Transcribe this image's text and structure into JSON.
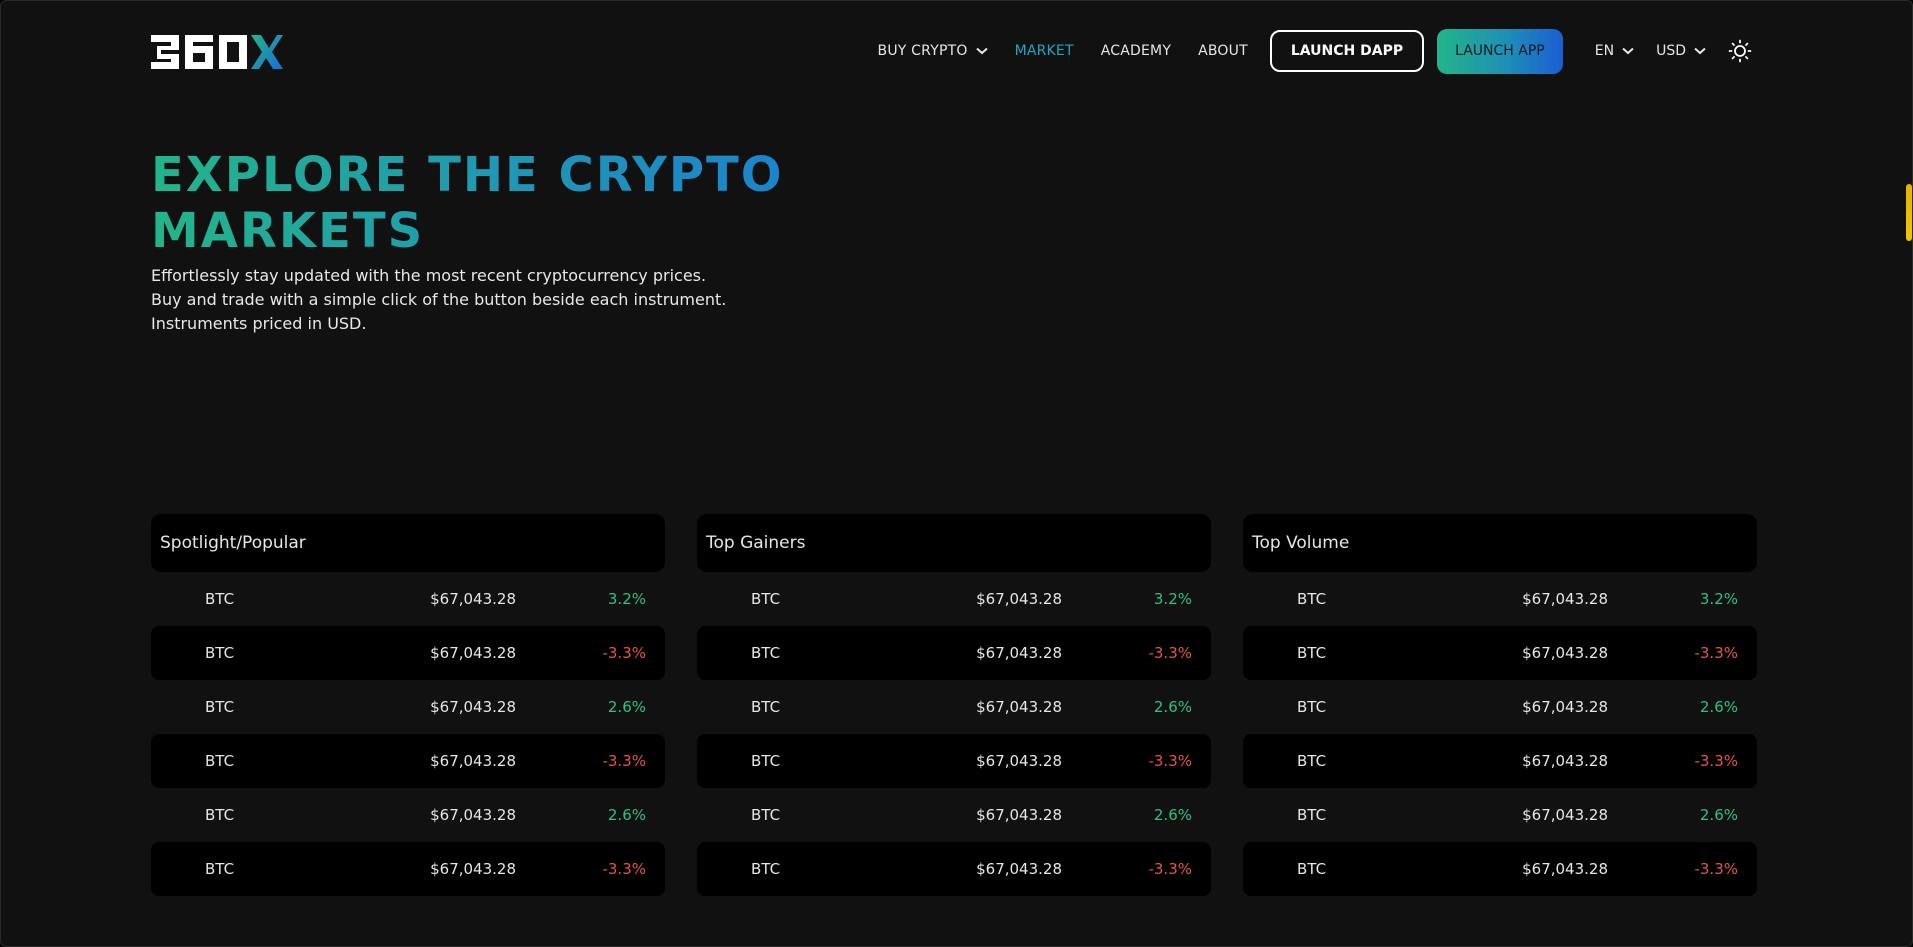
{
  "header": {
    "nav": [
      {
        "label": "BUY CRYPTO",
        "dropdown": true,
        "active": false
      },
      {
        "label": "MARKET",
        "dropdown": false,
        "active": true
      },
      {
        "label": "ACADEMY",
        "dropdown": false,
        "active": false
      },
      {
        "label": "ABOUT",
        "dropdown": false,
        "active": false
      }
    ],
    "launch_dapp": "LAUNCH DAPP",
    "launch_app": "LAUNCH APP",
    "language": "EN",
    "currency": "USD",
    "theme_icon": "sun-icon"
  },
  "hero": {
    "title_line1": "EXPLORE THE CRYPTO",
    "title_line2": "MARKETS",
    "desc": [
      "Effortlessly stay updated with the most recent cryptocurrency prices.",
      "Buy and trade with a simple click of the button beside each instrument.",
      "Instruments priced in USD."
    ]
  },
  "colors": {
    "accent_teal": "#1fa6c5",
    "positive": "#2ec27e",
    "negative": "#e5534b",
    "gradient_start": "#22b58a",
    "gradient_end": "#1a5ed3"
  },
  "markets": [
    {
      "title": "Spotlight/Popular",
      "rows": [
        {
          "symbol": "BTC",
          "price": "$67,043.28",
          "change": "3.2%",
          "dir": "pos"
        },
        {
          "symbol": "BTC",
          "price": "$67,043.28",
          "change": "-3.3%",
          "dir": "neg"
        },
        {
          "symbol": "BTC",
          "price": "$67,043.28",
          "change": "2.6%",
          "dir": "pos"
        },
        {
          "symbol": "BTC",
          "price": "$67,043.28",
          "change": "-3.3%",
          "dir": "neg"
        },
        {
          "symbol": "BTC",
          "price": "$67,043.28",
          "change": "2.6%",
          "dir": "pos"
        },
        {
          "symbol": "BTC",
          "price": "$67,043.28",
          "change": "-3.3%",
          "dir": "neg"
        }
      ]
    },
    {
      "title": "Top Gainers",
      "rows": [
        {
          "symbol": "BTC",
          "price": "$67,043.28",
          "change": "3.2%",
          "dir": "pos"
        },
        {
          "symbol": "BTC",
          "price": "$67,043.28",
          "change": "-3.3%",
          "dir": "neg"
        },
        {
          "symbol": "BTC",
          "price": "$67,043.28",
          "change": "2.6%",
          "dir": "pos"
        },
        {
          "symbol": "BTC",
          "price": "$67,043.28",
          "change": "-3.3%",
          "dir": "neg"
        },
        {
          "symbol": "BTC",
          "price": "$67,043.28",
          "change": "2.6%",
          "dir": "pos"
        },
        {
          "symbol": "BTC",
          "price": "$67,043.28",
          "change": "-3.3%",
          "dir": "neg"
        }
      ]
    },
    {
      "title": "Top Volume",
      "rows": [
        {
          "symbol": "BTC",
          "price": "$67,043.28",
          "change": "3.2%",
          "dir": "pos"
        },
        {
          "symbol": "BTC",
          "price": "$67,043.28",
          "change": "-3.3%",
          "dir": "neg"
        },
        {
          "symbol": "BTC",
          "price": "$67,043.28",
          "change": "2.6%",
          "dir": "pos"
        },
        {
          "symbol": "BTC",
          "price": "$67,043.28",
          "change": "-3.3%",
          "dir": "neg"
        },
        {
          "symbol": "BTC",
          "price": "$67,043.28",
          "change": "2.6%",
          "dir": "pos"
        },
        {
          "symbol": "BTC",
          "price": "$67,043.28",
          "change": "-3.3%",
          "dir": "neg"
        }
      ]
    }
  ]
}
